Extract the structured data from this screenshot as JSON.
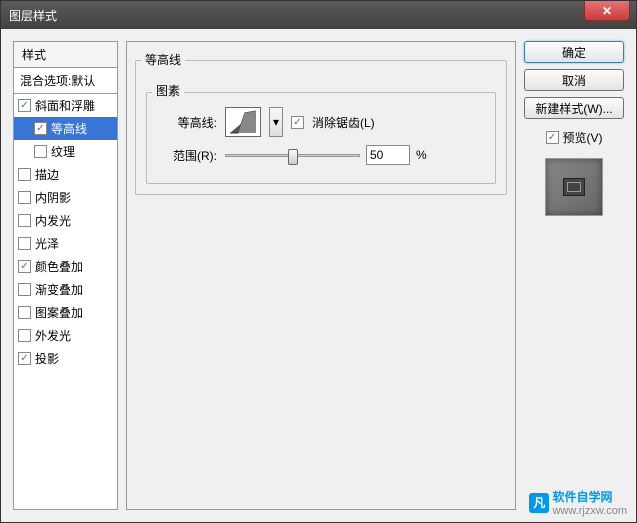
{
  "window": {
    "title": "图层样式"
  },
  "left": {
    "header": "样式",
    "blending": "混合选项:默认",
    "items": [
      {
        "label": "斜面和浮雕",
        "checked": true,
        "nested": false,
        "selected": false
      },
      {
        "label": "等高线",
        "checked": true,
        "nested": true,
        "selected": true
      },
      {
        "label": "纹理",
        "checked": false,
        "nested": true,
        "selected": false
      },
      {
        "label": "描边",
        "checked": false,
        "nested": false,
        "selected": false
      },
      {
        "label": "内阴影",
        "checked": false,
        "nested": false,
        "selected": false
      },
      {
        "label": "内发光",
        "checked": false,
        "nested": false,
        "selected": false
      },
      {
        "label": "光泽",
        "checked": false,
        "nested": false,
        "selected": false
      },
      {
        "label": "颜色叠加",
        "checked": true,
        "nested": false,
        "selected": false
      },
      {
        "label": "渐变叠加",
        "checked": false,
        "nested": false,
        "selected": false
      },
      {
        "label": "图案叠加",
        "checked": false,
        "nested": false,
        "selected": false
      },
      {
        "label": "外发光",
        "checked": false,
        "nested": false,
        "selected": false
      },
      {
        "label": "投影",
        "checked": true,
        "nested": false,
        "selected": false
      }
    ]
  },
  "middle": {
    "group_title": "等高线",
    "elements_title": "图素",
    "contour_label": "等高线:",
    "antialias_label": "消除锯齿(L)",
    "antialias_checked": true,
    "range_label": "范围(R):",
    "range_value": "50",
    "range_unit": "%"
  },
  "right": {
    "ok": "确定",
    "cancel": "取消",
    "new_style": "新建样式(W)...",
    "preview_label": "预览(V)",
    "preview_checked": true
  },
  "watermark": {
    "brand": "软件自学网",
    "url": "www.rjzxw.com"
  }
}
